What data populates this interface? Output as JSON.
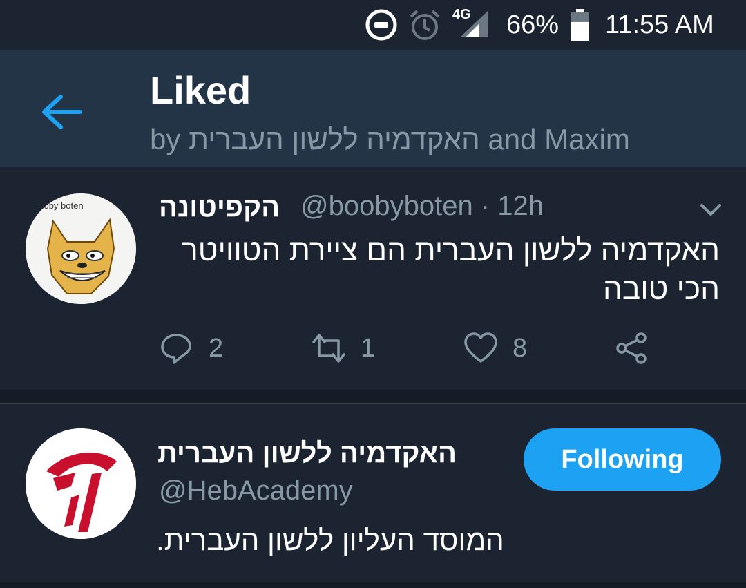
{
  "status_bar": {
    "network_label": "4G",
    "battery_percent": "66%",
    "battery_level": 0.66,
    "time": "11:55 AM",
    "icons": [
      "do-not-disturb-icon",
      "alarm-icon",
      "signal-icon",
      "battery-icon"
    ]
  },
  "header": {
    "title": "Liked",
    "subtitle": "by האקדמיה ללשון העברית and Maxim",
    "back_icon": "arrow-left-icon",
    "accent_color": "#1da1f2"
  },
  "tweet": {
    "display_name": "הקפיטונה",
    "handle_time": "@boobyboten · 12h",
    "avatar_caption": "booby boten",
    "text": "האקדמיה ללשון העברית הם ציירת הטוויטר הכי טובה",
    "actions": {
      "reply_count": "2",
      "retweet_count": "1",
      "like_count": "8"
    }
  },
  "user_card": {
    "display_name": "האקדמיה ללשון העברית",
    "handle": "@HebAcademy",
    "bio": "המוסד העליון ללשון העברית.",
    "follow_label": "Following",
    "brand_color": "#c8102e"
  }
}
